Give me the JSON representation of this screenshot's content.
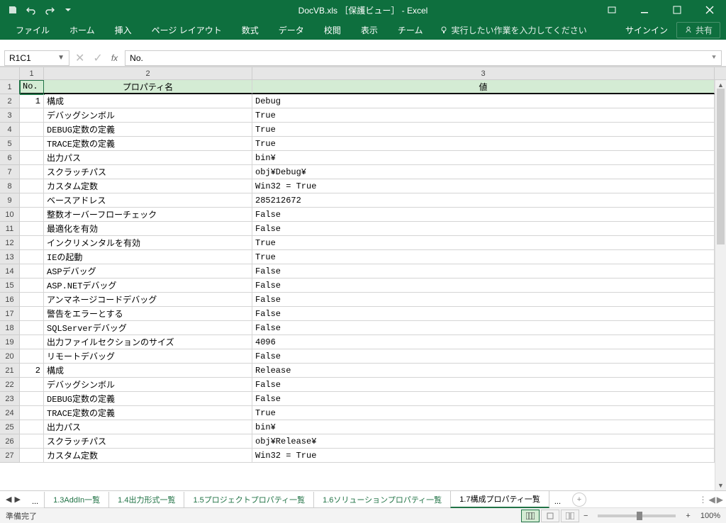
{
  "title": "DocVB.xls ［保護ビュー］ - Excel",
  "qat": {
    "save": "save",
    "undo": "undo",
    "redo": "redo"
  },
  "ribbon": {
    "tabs": [
      "ファイル",
      "ホーム",
      "挿入",
      "ページ レイアウト",
      "数式",
      "データ",
      "校閲",
      "表示",
      "チーム"
    ],
    "tell_me": "実行したい作業を入力してください",
    "signin": "サインイン",
    "share": "共有"
  },
  "name_box": "R1C1",
  "formula_label": "fx",
  "formula_value": "No.",
  "col_headers": [
    "1",
    "2",
    "3"
  ],
  "header_row": {
    "no": "No.",
    "prop": "プロパティ名",
    "val": "値"
  },
  "rows": [
    {
      "rh": "1",
      "no": "",
      "prop": "",
      "val": "",
      "is_header": true
    },
    {
      "rh": "2",
      "no": "1",
      "prop": "構成",
      "val": "Debug"
    },
    {
      "rh": "3",
      "no": "",
      "prop": "デバッグシンボル",
      "val": "True"
    },
    {
      "rh": "4",
      "no": "",
      "prop": "DEBUG定数の定義",
      "val": "True"
    },
    {
      "rh": "5",
      "no": "",
      "prop": "TRACE定数の定義",
      "val": "True"
    },
    {
      "rh": "6",
      "no": "",
      "prop": "出力パス",
      "val": "bin¥"
    },
    {
      "rh": "7",
      "no": "",
      "prop": "スクラッチパス",
      "val": "obj¥Debug¥"
    },
    {
      "rh": "8",
      "no": "",
      "prop": "カスタム定数",
      "val": "Win32 = True"
    },
    {
      "rh": "9",
      "no": "",
      "prop": "ベースアドレス",
      "val": "285212672"
    },
    {
      "rh": "10",
      "no": "",
      "prop": "整数オーバーフローチェック",
      "val": "False"
    },
    {
      "rh": "11",
      "no": "",
      "prop": "最適化を有効",
      "val": "False"
    },
    {
      "rh": "12",
      "no": "",
      "prop": "インクリメンタルを有効",
      "val": "True"
    },
    {
      "rh": "13",
      "no": "",
      "prop": "IEの起動",
      "val": "True"
    },
    {
      "rh": "14",
      "no": "",
      "prop": "ASPデバッグ",
      "val": "False"
    },
    {
      "rh": "15",
      "no": "",
      "prop": "ASP.NETデバッグ",
      "val": "False"
    },
    {
      "rh": "16",
      "no": "",
      "prop": "アンマネージコードデバッグ",
      "val": "False"
    },
    {
      "rh": "17",
      "no": "",
      "prop": "警告をエラーとする",
      "val": "False"
    },
    {
      "rh": "18",
      "no": "",
      "prop": "SQLServerデバッグ",
      "val": "False"
    },
    {
      "rh": "19",
      "no": "",
      "prop": "出力ファイルセクションのサイズ",
      "val": "4096"
    },
    {
      "rh": "20",
      "no": "",
      "prop": "リモートデバッグ",
      "val": "False"
    },
    {
      "rh": "21",
      "no": "2",
      "prop": "構成",
      "val": "Release"
    },
    {
      "rh": "22",
      "no": "",
      "prop": "デバッグシンボル",
      "val": "False"
    },
    {
      "rh": "23",
      "no": "",
      "prop": "DEBUG定数の定義",
      "val": "False"
    },
    {
      "rh": "24",
      "no": "",
      "prop": "TRACE定数の定義",
      "val": "True"
    },
    {
      "rh": "25",
      "no": "",
      "prop": "出力パス",
      "val": "bin¥"
    },
    {
      "rh": "26",
      "no": "",
      "prop": "スクラッチパス",
      "val": "obj¥Release¥"
    },
    {
      "rh": "27",
      "no": "",
      "prop": "カスタム定数",
      "val": "Win32 = True"
    }
  ],
  "sheet_tabs": {
    "ellipsis_left": "...",
    "tabs": [
      {
        "label": "1.3AddIn一覧",
        "active": false
      },
      {
        "label": "1.4出力形式一覧",
        "active": false
      },
      {
        "label": "1.5プロジェクトプロパティ一覧",
        "active": false
      },
      {
        "label": "1.6ソリューションプロパティ一覧",
        "active": false
      },
      {
        "label": "1.7構成プロパティ一覧",
        "active": true
      }
    ],
    "ellipsis_right": "..."
  },
  "statusbar": {
    "ready": "準備完了",
    "zoom": "100%"
  }
}
